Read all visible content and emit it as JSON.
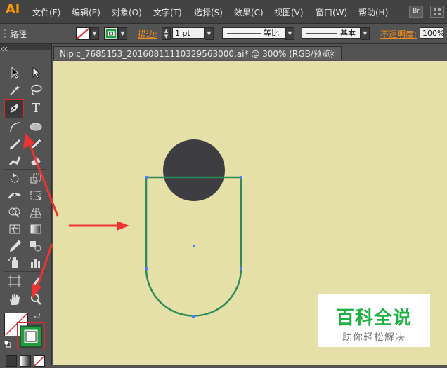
{
  "app": {
    "logo": "Ai"
  },
  "menu": [
    "文件(F)",
    "编辑(E)",
    "对象(O)",
    "文字(T)",
    "选择(S)",
    "效果(C)",
    "视图(V)",
    "窗口(W)",
    "帮助(H)"
  ],
  "menu_extra": {
    "bridge_label": "Br"
  },
  "control": {
    "selection_label": "路径",
    "stroke_label": "描边:",
    "stroke_value": "1 pt",
    "profile_label": "等比",
    "brush_label": "基本",
    "opacity_label": "不透明度:",
    "opacity_value": "100%"
  },
  "document": {
    "tab_title": "Nipic_7685153_20160811110329563000.ai*  @  300%  (RGB/预览)",
    "close_glyph": "×"
  },
  "tools": {
    "selected": "pen-tool",
    "type_glyph": "T"
  },
  "colors": {
    "canvas_bg": "#e5dfa8",
    "circle_fill": "#3d3d42",
    "path_stroke": "#2e8b57",
    "anchor": "#4a7cff",
    "arrow": "#ee3333",
    "highlight": "#d62b2b",
    "stroke_swatch": "#1e9e3c"
  },
  "watermark": {
    "title": "百科全说",
    "subtitle": "助你轻松解决"
  }
}
